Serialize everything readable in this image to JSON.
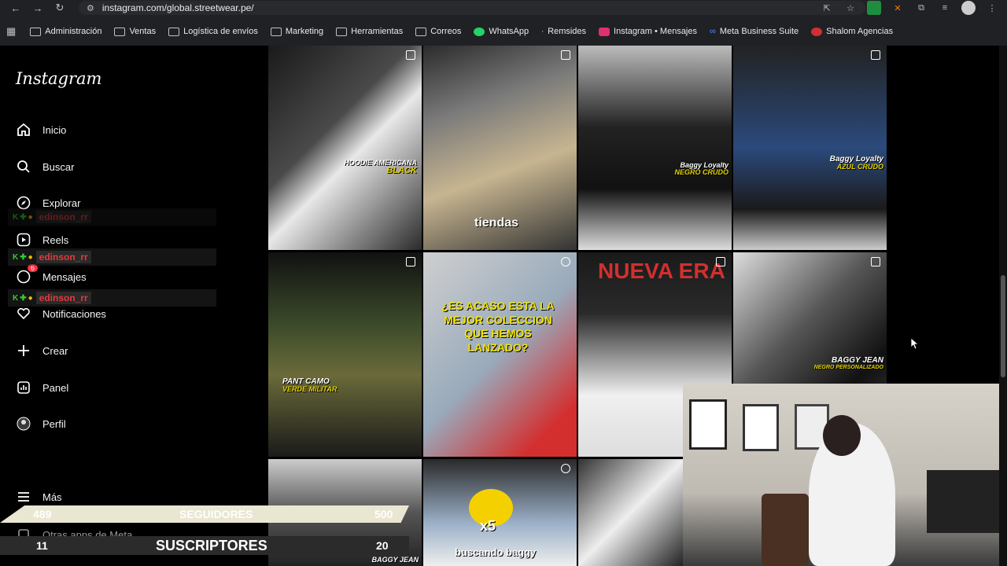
{
  "browser": {
    "url": "instagram.com/global.streetwear.pe/",
    "bookmarks": [
      {
        "label": "Administración",
        "icon": "folder-icon"
      },
      {
        "label": "Ventas",
        "icon": "folder-icon"
      },
      {
        "label": "Logística de envíos",
        "icon": "folder-icon"
      },
      {
        "label": "Marketing",
        "icon": "folder-icon"
      },
      {
        "label": "Herramientas",
        "icon": "folder-icon"
      },
      {
        "label": "Correos",
        "icon": "folder-icon"
      },
      {
        "label": "WhatsApp",
        "icon": "whatsapp-icon"
      },
      {
        "label": "Remsides",
        "icon": "remsides-icon"
      },
      {
        "label": "Instagram • Mensajes",
        "icon": "instagram-icon"
      },
      {
        "label": "Meta Business Suite",
        "icon": "meta-icon"
      },
      {
        "label": "Shalom Agencias",
        "icon": "shalom-icon"
      }
    ]
  },
  "sidebar": {
    "logo": "Instagram",
    "items": [
      {
        "label": "Inicio",
        "icon": "home-icon"
      },
      {
        "label": "Buscar",
        "icon": "search-icon"
      },
      {
        "label": "Explorar",
        "icon": "compass-icon"
      },
      {
        "label": "Reels",
        "icon": "reels-icon"
      },
      {
        "label": "Mensajes",
        "icon": "messenger-icon",
        "badge": "6"
      },
      {
        "label": "Notificaciones",
        "icon": "heart-icon"
      },
      {
        "label": "Crear",
        "icon": "plus-icon"
      },
      {
        "label": "Panel",
        "icon": "panel-icon"
      },
      {
        "label": "Perfil",
        "icon": "profile-icon"
      },
      {
        "label": "Más",
        "icon": "menu-icon"
      },
      {
        "label": "Otras apps de Meta",
        "icon": "meta-apps-icon"
      }
    ]
  },
  "overlay_chat": {
    "username": "edinson_rr"
  },
  "posts": [
    {
      "label": "HOODIE AMERICANA",
      "sub": "BLACK"
    },
    {
      "label": "tiendas",
      "sub": ""
    },
    {
      "label": "Baggy Loyalty",
      "sub": "NEGRO CRUDO"
    },
    {
      "label": "Baggy Loyalty",
      "sub": "AZUL CRUDO"
    },
    {
      "label": "PANT CAMO",
      "sub": "VERDE MILITAR"
    },
    {
      "label": "¿ES ACASO ESTA LA MEJOR COLECCION QUE HEMOS LANZADO?",
      "sub": ""
    },
    {
      "label": "NUEVA ERA",
      "sub": ""
    },
    {
      "label": "BAGGY JEAN",
      "sub": "NEGRO PERSONALIZADO"
    },
    {
      "label": "BAGGY JEAN",
      "sub": ""
    },
    {
      "label": "buscando baggy",
      "sub": "x5"
    }
  ],
  "stream_overlay": {
    "followers_current": "489",
    "followers_label": "SEGUIDORES",
    "followers_goal": "500",
    "subs_current": "11",
    "subs_label": "SUSCRIPTORES",
    "subs_goal": "20"
  },
  "colors": {
    "accent_red": "#e43a3a",
    "overlay_bar": "#e9e7d2",
    "label_yellow": "#e6d200"
  }
}
